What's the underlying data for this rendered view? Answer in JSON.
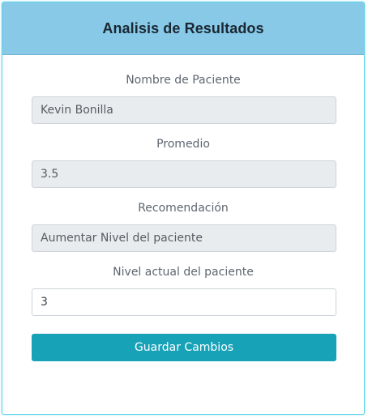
{
  "header": {
    "title": "Analisis de Resultados"
  },
  "form": {
    "fields": [
      {
        "label": "Nombre de Paciente",
        "value": "Kevin Bonilla"
      },
      {
        "label": "Promedio",
        "value": "3.5"
      },
      {
        "label": "Recomendación",
        "value": "Aumentar Nivel del paciente"
      },
      {
        "label": "Nivel actual del paciente",
        "value": "3"
      }
    ],
    "submit_label": "Guardar Cambios"
  },
  "colors": {
    "header_background": "#87c9e6",
    "button_background": "#17a2b8",
    "readonly_field_background": "#e9ecef",
    "card_border": "#5fd4e8"
  }
}
